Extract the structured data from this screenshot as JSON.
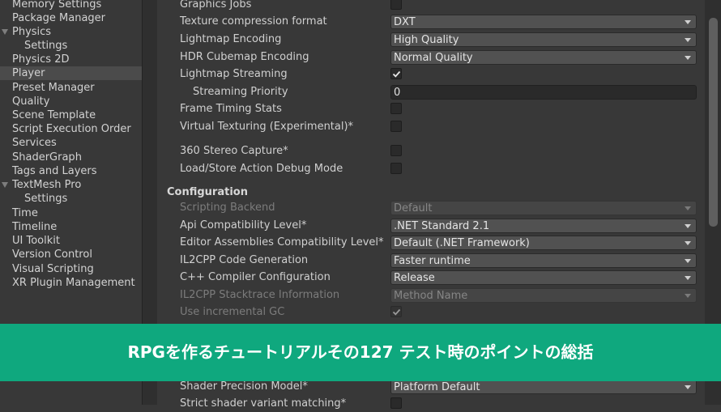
{
  "sidebar": {
    "items": [
      {
        "label": "Memory Settings"
      },
      {
        "label": "Package Manager"
      },
      {
        "label": "Physics"
      },
      {
        "label": "Settings"
      },
      {
        "label": "Physics 2D"
      },
      {
        "label": "Player"
      },
      {
        "label": "Preset Manager"
      },
      {
        "label": "Quality"
      },
      {
        "label": "Scene Template"
      },
      {
        "label": "Script Execution Order"
      },
      {
        "label": "Services"
      },
      {
        "label": "ShaderGraph"
      },
      {
        "label": "Tags and Layers"
      },
      {
        "label": "TextMesh Pro"
      },
      {
        "label": "Settings"
      },
      {
        "label": "Time"
      },
      {
        "label": "Timeline"
      },
      {
        "label": "UI Toolkit"
      },
      {
        "label": "Version Control"
      },
      {
        "label": "Visual Scripting"
      },
      {
        "label": "XR Plugin Management"
      }
    ]
  },
  "settings": {
    "graphics_jobs": {
      "label": "Graphics Jobs",
      "checked": false
    },
    "texture_compression": {
      "label": "Texture compression format",
      "value": "DXT"
    },
    "lightmap_encoding": {
      "label": "Lightmap Encoding",
      "value": "High Quality"
    },
    "hdr_cubemap_encoding": {
      "label": "HDR Cubemap Encoding",
      "value": "Normal Quality"
    },
    "lightmap_streaming": {
      "label": "Lightmap Streaming",
      "checked": true
    },
    "streaming_priority": {
      "label": "Streaming Priority",
      "value": "0"
    },
    "frame_timing_stats": {
      "label": "Frame Timing Stats",
      "checked": false
    },
    "virtual_texturing": {
      "label": "Virtual Texturing (Experimental)*",
      "checked": false
    },
    "stereo_capture": {
      "label": "360 Stereo Capture*",
      "checked": false
    },
    "load_store_debug": {
      "label": "Load/Store Action Debug Mode",
      "checked": false
    }
  },
  "configuration": {
    "title": "Configuration",
    "scripting_backend": {
      "label": "Scripting Backend",
      "value": "Default"
    },
    "api_compatibility": {
      "label": "Api Compatibility Level*",
      "value": ".NET Standard 2.1"
    },
    "editor_assemblies": {
      "label": "Editor Assemblies Compatibility Level*",
      "value": "Default (.NET Framework)"
    },
    "il2cpp_codegen": {
      "label": "IL2CPP Code Generation",
      "value": "Faster runtime"
    },
    "cpp_compiler": {
      "label": "C++ Compiler Configuration",
      "value": "Release"
    },
    "il2cpp_stacktrace": {
      "label": "IL2CPP Stacktrace Information",
      "value": "Method Name"
    },
    "incremental_gc": {
      "label": "Use incremental GC",
      "checked": true
    },
    "shader_precision": {
      "label": "Shader Precision Model*",
      "value": "Platform Default"
    },
    "strict_shader": {
      "label": "Strict shader variant matching*",
      "checked": false
    }
  },
  "banner": {
    "text": "RPGを作るチュートリアルその127 テスト時のポイントの総括",
    "color": "#0fa87e"
  },
  "icons": {
    "expand": "triangle-down-icon",
    "dropdown": "chevron-down-icon",
    "check": "checkmark-icon"
  }
}
